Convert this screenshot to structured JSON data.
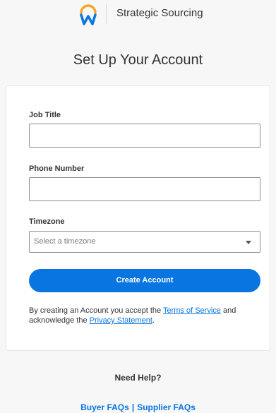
{
  "header": {
    "brand_name": "Strategic Sourcing"
  },
  "page_title": "Set Up Your Account",
  "form": {
    "job_title_label": "Job Title",
    "job_title_value": "",
    "phone_label": "Phone Number",
    "phone_value": "",
    "timezone_label": "Timezone",
    "timezone_placeholder": "Select a timezone",
    "submit_label": "Create Account"
  },
  "legal": {
    "text_before": "By creating an Account you accept the ",
    "terms_link": "Terms of Service",
    "text_middle": " and acknowledge the ",
    "privacy_link": "Privacy Statement",
    "text_after": "."
  },
  "help": {
    "title": "Need Help?",
    "buyer_faqs": "Buyer FAQs",
    "separator": "|",
    "supplier_faqs": "Supplier FAQs"
  },
  "colors": {
    "accent": "#0875e1",
    "logo_orange": "#f5a623",
    "logo_blue": "#0875e1"
  },
  "icons": {
    "logo": "workday-logo-icon",
    "dropdown": "chevron-down-icon"
  }
}
